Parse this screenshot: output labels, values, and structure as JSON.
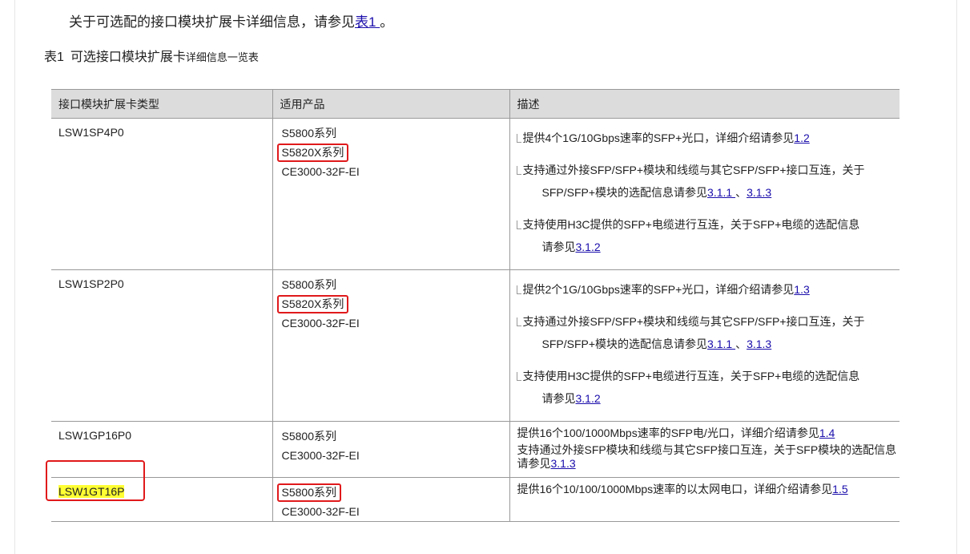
{
  "intro": {
    "prefix": "关于可选配的接口模块扩展卡详细信息，请参见",
    "link": "表1 ",
    "suffix": "。"
  },
  "caption": {
    "number": "表1",
    "main": "可选接口模块扩展卡",
    "small": "详细信息一览表"
  },
  "table": {
    "headers": [
      "接口模块扩展卡类型",
      "适用产品",
      "描述"
    ],
    "rows": [
      {
        "type": "LSW1SP4P0",
        "products": [
          "S5800系列",
          "S5820X系列",
          "CE3000-32F-EI"
        ],
        "desc": [
          {
            "text": "提供4个1G/10Gbps速率的SFP+光口，详细介绍请参见",
            "links": [
              "1.2"
            ]
          },
          {
            "text": "支持通过外接SFP/SFP+模块和线缆与其它SFP/SFP+接口互连，关于",
            "cont": "SFP/SFP+模块的选配信息请参见",
            "links": [
              "3.1.1 ",
              "3.1.3"
            ],
            "sep": "、"
          },
          {
            "text": "支持使用H3C提供的SFP+电缆进行互连，关于SFP+电缆的选配信息",
            "cont": "请参见",
            "links": [
              "3.1.2"
            ]
          }
        ]
      },
      {
        "type": "LSW1SP2P0",
        "products": [
          "S5800系列",
          "S5820X系列",
          "CE3000-32F-EI"
        ],
        "desc": [
          {
            "text": "提供2个1G/10Gbps速率的SFP+光口，详细介绍请参见",
            "links": [
              "1.3"
            ]
          },
          {
            "text": "支持通过外接SFP/SFP+模块和线缆与其它SFP/SFP+接口互连，关于",
            "cont": "SFP/SFP+模块的选配信息请参见",
            "links": [
              "3.1.1 ",
              "3.1.3"
            ],
            "sep": "、"
          },
          {
            "text": "支持使用H3C提供的SFP+电缆进行互连，关于SFP+电缆的选配信息",
            "cont": "请参见",
            "links": [
              "3.1.2"
            ]
          }
        ]
      },
      {
        "type": "LSW1GP16P0",
        "products": [
          "S5800系列",
          "CE3000-32F-EI"
        ],
        "desc": [
          {
            "text": "提供16个100/1000Mbps速率的SFP电/光口，详细介绍请参见",
            "links": [
              "1.4"
            ]
          },
          {
            "text": "支持通过外接SFP模块和线缆与其它SFP接口互连，关于SFP模块的选配信息请参见",
            "links": [
              "3.1.3"
            ]
          }
        ]
      },
      {
        "type": "LSW1GT16P",
        "products": [
          "S5800系列",
          "CE3000-32F-EI"
        ],
        "desc": [
          {
            "text": "提供16个10/100/1000Mbps速率的以太网电口，详细介绍请参见",
            "links": [
              "1.5"
            ]
          }
        ]
      }
    ]
  },
  "colors": {
    "highlight": "#ffff33",
    "annotation_red": "#e0191b",
    "link": "#1a0dab",
    "header_bg": "#dcdcdc"
  }
}
